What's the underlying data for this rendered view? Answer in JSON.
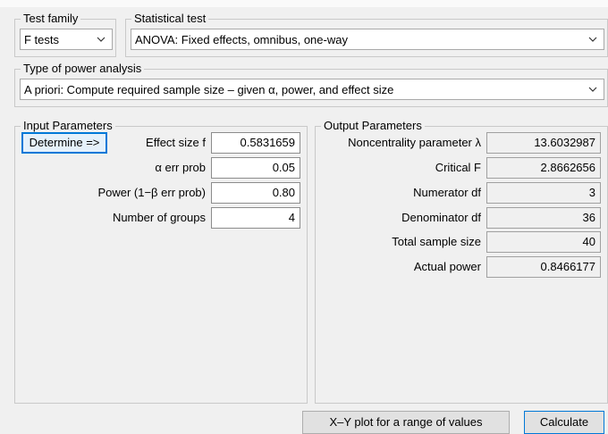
{
  "test_family": {
    "legend": "Test family",
    "selected": "F tests"
  },
  "statistical_test": {
    "legend": "Statistical test",
    "selected": "ANOVA: Fixed effects, omnibus, one-way"
  },
  "power_analysis": {
    "legend": "Type of power analysis",
    "selected": "A priori: Compute required sample size – given α, power, and effect size"
  },
  "input_parameters": {
    "legend": "Input Parameters",
    "determine_label": "Determine =>",
    "fields": [
      {
        "label": "Effect size f",
        "value": "0.5831659"
      },
      {
        "label": "α err prob",
        "value": "0.05"
      },
      {
        "label": "Power (1−β err prob)",
        "value": "0.80"
      },
      {
        "label": "Number of groups",
        "value": "4"
      }
    ]
  },
  "output_parameters": {
    "legend": "Output Parameters",
    "fields": [
      {
        "label": "Noncentrality parameter λ",
        "value": "13.6032987"
      },
      {
        "label": "Critical F",
        "value": "2.8662656"
      },
      {
        "label": "Numerator df",
        "value": "3"
      },
      {
        "label": "Denominator df",
        "value": "36"
      },
      {
        "label": "Total sample size",
        "value": "40"
      },
      {
        "label": "Actual power",
        "value": "0.8466177"
      }
    ]
  },
  "buttons": {
    "xy_plot": "X–Y plot for a range of values",
    "calculate": "Calculate"
  }
}
